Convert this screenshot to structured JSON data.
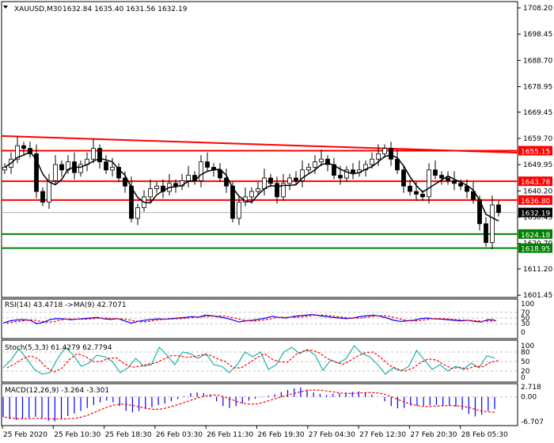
{
  "header": {
    "symbol": "XAUUSD,M30",
    "ohlc": "1632.84 1635.40 1631.56 1632.19"
  },
  "colors": {
    "red": "#ff0000",
    "green": "#008000",
    "bull": "#000000",
    "ma": "#000000",
    "rsi": "#0000ff",
    "stoch_main": "#20b2aa",
    "signal": "#ff0000",
    "macd": "#0000ff"
  },
  "chart_data": [
    {
      "type": "candlestick",
      "title": "XAUUSD,M30",
      "ylim": [
        1601.45,
        1708.2
      ],
      "y_ticks": [
        "1708.20",
        "1698.45",
        "1688.70",
        "1678.95",
        "1669.45",
        "1659.70",
        "1649.95",
        "1640.20",
        "1630.45",
        "1620.70",
        "1611.20",
        "1601.45"
      ],
      "closes": [
        1649,
        1652,
        1657,
        1656,
        1654,
        1640,
        1636,
        1644,
        1650,
        1648,
        1651,
        1647,
        1650,
        1652,
        1656,
        1651,
        1648,
        1649,
        1645,
        1642,
        1630,
        1634,
        1638,
        1641,
        1642,
        1640,
        1643,
        1642,
        1644,
        1646,
        1644,
        1651,
        1649,
        1648,
        1645,
        1642,
        1630,
        1636,
        1638,
        1640,
        1641,
        1645,
        1643,
        1638,
        1643,
        1645,
        1644,
        1648,
        1649,
        1651,
        1652,
        1650,
        1646,
        1645,
        1648,
        1647,
        1648,
        1650,
        1652,
        1654,
        1656,
        1652,
        1648,
        1642,
        1640,
        1639,
        1638,
        1648,
        1646,
        1645,
        1644,
        1643,
        1642,
        1640,
        1637,
        1628,
        1621,
        1635,
        1632.19
      ],
      "trendline": {
        "from": 1660.6,
        "to": 1654.4
      },
      "levels": [
        {
          "label": "1655.15",
          "value": 1655.15,
          "color": "#ff0000"
        },
        {
          "label": "1643.78",
          "value": 1643.78,
          "color": "#ff0000"
        },
        {
          "label": "1636.80",
          "value": 1636.8,
          "color": "#ff0000"
        },
        {
          "label": "1624.18",
          "value": 1624.18,
          "color": "#008000"
        },
        {
          "label": "1618.95",
          "value": 1618.95,
          "color": "#008000"
        }
      ],
      "current": {
        "label": "1632.19",
        "value": 1632.19
      },
      "x_labels": [
        "25 Feb 2020",
        "25 Feb 10:30",
        "25 Feb 18:30",
        "26 Feb 03:30",
        "26 Feb 11:30",
        "26 Feb 19:30",
        "27 Feb 04:30",
        "27 Feb 12:30",
        "27 Feb 20:30",
        "28 Feb 05:30"
      ]
    },
    {
      "type": "line",
      "title": "RSI(14) 43.4718  ->MA(9) 42.7071",
      "ylim": [
        0,
        100
      ],
      "y_ticks": [
        "100",
        "70",
        "50",
        "30",
        "0"
      ],
      "levels": [
        70,
        50,
        30
      ],
      "values": [
        32,
        40,
        43,
        44,
        42,
        30,
        35,
        45,
        48,
        47,
        44,
        46,
        48,
        50,
        52,
        47,
        45,
        48,
        40,
        32,
        38,
        42,
        45,
        47,
        46,
        48,
        50,
        52,
        55,
        53,
        60,
        58,
        54,
        50,
        44,
        36,
        40,
        42,
        46,
        50,
        56,
        52,
        50,
        55,
        58,
        60,
        62,
        58,
        55,
        52,
        50,
        48,
        50,
        55,
        58,
        60,
        56,
        50,
        42,
        38,
        40,
        42,
        48,
        50,
        47,
        46,
        44,
        42,
        40,
        42,
        38,
        36,
        44,
        43
      ]
    },
    {
      "type": "line",
      "title": "Stoch(5,3,3) 61.4279 62.7794",
      "ylim": [
        0,
        100
      ],
      "y_ticks": [
        "100",
        "80",
        "50",
        "20",
        "0"
      ],
      "levels": [
        80,
        50,
        20
      ],
      "values": [
        30,
        55,
        90,
        60,
        25,
        10,
        15,
        60,
        95,
        70,
        35,
        45,
        70,
        65,
        50,
        15,
        30,
        60,
        35,
        40,
        95,
        70,
        40,
        80,
        75,
        60,
        75,
        40,
        35,
        15,
        40,
        80,
        65,
        80,
        25,
        40,
        80,
        95,
        75,
        88,
        70,
        22,
        55,
        45,
        60,
        100,
        75,
        65,
        40,
        10,
        30,
        20,
        35,
        85,
        55,
        25,
        40,
        20,
        35,
        25,
        45,
        30,
        68,
        61
      ]
    },
    {
      "type": "bar",
      "title": "MACD(12,26,9) -3.264 -3.301",
      "ylim": [
        -6.707,
        2.718
      ],
      "y_ticks": [
        "2.718",
        "0.00",
        "-6.707"
      ],
      "values": [
        -5.5,
        -6,
        -6.2,
        -6,
        -5.7,
        -5.4,
        -5.8,
        -6.5,
        -6.6,
        -6,
        -5.2,
        -4.5,
        -3.8,
        -3,
        -2.2,
        -1.5,
        -1,
        -1.5,
        -2.5,
        -3.8,
        -4.2,
        -3.8,
        -3.2,
        -2.8,
        -2.2,
        -1.8,
        -1.2,
        -0.6,
        0.2,
        1,
        1.2,
        1,
        0.4,
        -1.2,
        -2.5,
        -3,
        -2.5,
        -1.8,
        -1,
        -0.5,
        -0.1,
        0.3,
        0.7,
        1.3,
        1.9,
        2.3,
        2.5,
        2,
        1.2,
        0.8,
        0.5,
        0.8,
        1,
        1.2,
        1.4,
        1.5,
        1.2,
        0.6,
        0,
        -1.2,
        -2.5,
        -3.1,
        -3,
        -2.4,
        -2.4,
        -2.4,
        -2.3,
        -2.2,
        -2.5,
        -2.5,
        -2.6,
        -3.5,
        -4.6,
        -5.3,
        -4.8,
        -3.8,
        -3.3
      ],
      "signal_label": "0.00"
    }
  ]
}
